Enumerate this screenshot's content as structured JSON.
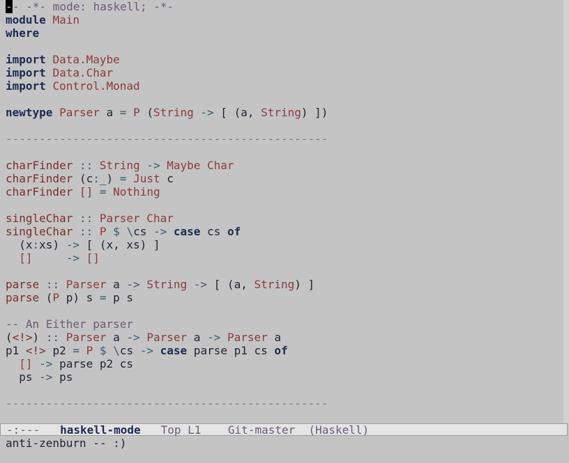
{
  "buffer": {
    "lines": [
      [
        {
          "t": "cursor",
          "s": "-"
        },
        {
          "t": "comment",
          "s": "- -*- mode: haskell; -*-"
        }
      ],
      [
        {
          "t": "keyword",
          "s": "module"
        },
        {
          "t": "plain",
          "s": " "
        },
        {
          "t": "type",
          "s": "Main"
        }
      ],
      [
        {
          "t": "keyword",
          "s": "where"
        }
      ],
      [],
      [
        {
          "t": "keyword",
          "s": "import"
        },
        {
          "t": "plain",
          "s": " "
        },
        {
          "t": "type",
          "s": "Data.Maybe"
        }
      ],
      [
        {
          "t": "keyword",
          "s": "import"
        },
        {
          "t": "plain",
          "s": " "
        },
        {
          "t": "type",
          "s": "Data.Char"
        }
      ],
      [
        {
          "t": "keyword",
          "s": "import"
        },
        {
          "t": "plain",
          "s": " "
        },
        {
          "t": "type",
          "s": "Control.Monad"
        }
      ],
      [],
      [
        {
          "t": "keyword",
          "s": "newtype"
        },
        {
          "t": "plain",
          "s": " "
        },
        {
          "t": "type",
          "s": "Parser"
        },
        {
          "t": "plain",
          "s": " a "
        },
        {
          "t": "op",
          "s": "="
        },
        {
          "t": "plain",
          "s": " "
        },
        {
          "t": "type",
          "s": "P"
        },
        {
          "t": "plain",
          "s": " ("
        },
        {
          "t": "type",
          "s": "String"
        },
        {
          "t": "plain",
          "s": " "
        },
        {
          "t": "op",
          "s": "->"
        },
        {
          "t": "plain",
          "s": " [ (a, "
        },
        {
          "t": "type",
          "s": "String"
        },
        {
          "t": "plain",
          "s": ") ])"
        }
      ],
      [],
      [
        {
          "t": "sep",
          "s": "------------------------------------------------"
        }
      ],
      [],
      [
        {
          "t": "func",
          "s": "charFinder"
        },
        {
          "t": "plain",
          "s": " "
        },
        {
          "t": "op",
          "s": "::"
        },
        {
          "t": "plain",
          "s": " "
        },
        {
          "t": "type",
          "s": "String"
        },
        {
          "t": "plain",
          "s": " "
        },
        {
          "t": "op",
          "s": "->"
        },
        {
          "t": "plain",
          "s": " "
        },
        {
          "t": "type",
          "s": "Maybe Char"
        }
      ],
      [
        {
          "t": "func",
          "s": "charFinder"
        },
        {
          "t": "plain",
          "s": " (c"
        },
        {
          "t": "op",
          "s": ":"
        },
        {
          "t": "plain",
          "s": "_) "
        },
        {
          "t": "op",
          "s": "="
        },
        {
          "t": "plain",
          "s": " "
        },
        {
          "t": "type",
          "s": "Just"
        },
        {
          "t": "plain",
          "s": " c"
        }
      ],
      [
        {
          "t": "func",
          "s": "charFinder"
        },
        {
          "t": "plain",
          "s": " "
        },
        {
          "t": "bracket",
          "s": "[]"
        },
        {
          "t": "plain",
          "s": " "
        },
        {
          "t": "op",
          "s": "="
        },
        {
          "t": "plain",
          "s": " "
        },
        {
          "t": "type",
          "s": "Nothing"
        }
      ],
      [],
      [
        {
          "t": "func",
          "s": "singleChar"
        },
        {
          "t": "plain",
          "s": " "
        },
        {
          "t": "op",
          "s": "::"
        },
        {
          "t": "plain",
          "s": " "
        },
        {
          "t": "type",
          "s": "Parser Char"
        }
      ],
      [
        {
          "t": "func",
          "s": "singleChar"
        },
        {
          "t": "plain",
          "s": " "
        },
        {
          "t": "op",
          "s": "::"
        },
        {
          "t": "plain",
          "s": " "
        },
        {
          "t": "type",
          "s": "P"
        },
        {
          "t": "plain",
          "s": " "
        },
        {
          "t": "op",
          "s": "$"
        },
        {
          "t": "plain",
          "s": " "
        },
        {
          "t": "op",
          "s": "\\"
        },
        {
          "t": "plain",
          "s": "cs "
        },
        {
          "t": "op",
          "s": "->"
        },
        {
          "t": "plain",
          "s": " "
        },
        {
          "t": "keyword",
          "s": "case"
        },
        {
          "t": "plain",
          "s": " cs "
        },
        {
          "t": "keyword",
          "s": "of"
        }
      ],
      [
        {
          "t": "plain",
          "s": "  (x"
        },
        {
          "t": "op",
          "s": ":"
        },
        {
          "t": "plain",
          "s": "xs) "
        },
        {
          "t": "op",
          "s": "->"
        },
        {
          "t": "plain",
          "s": " [ (x, xs) ]"
        }
      ],
      [
        {
          "t": "plain",
          "s": "  "
        },
        {
          "t": "bracket",
          "s": "[]"
        },
        {
          "t": "plain",
          "s": "     "
        },
        {
          "t": "op",
          "s": "->"
        },
        {
          "t": "plain",
          "s": " "
        },
        {
          "t": "bracket",
          "s": "[]"
        }
      ],
      [],
      [
        {
          "t": "func",
          "s": "parse"
        },
        {
          "t": "plain",
          "s": " "
        },
        {
          "t": "op",
          "s": "::"
        },
        {
          "t": "plain",
          "s": " "
        },
        {
          "t": "type",
          "s": "Parser"
        },
        {
          "t": "plain",
          "s": " a "
        },
        {
          "t": "op",
          "s": "->"
        },
        {
          "t": "plain",
          "s": " "
        },
        {
          "t": "type",
          "s": "String"
        },
        {
          "t": "plain",
          "s": " "
        },
        {
          "t": "op",
          "s": "->"
        },
        {
          "t": "plain",
          "s": " [ (a, "
        },
        {
          "t": "type",
          "s": "String"
        },
        {
          "t": "plain",
          "s": ") ]"
        }
      ],
      [
        {
          "t": "func",
          "s": "parse"
        },
        {
          "t": "plain",
          "s": " ("
        },
        {
          "t": "type",
          "s": "P"
        },
        {
          "t": "plain",
          "s": " p) s "
        },
        {
          "t": "op",
          "s": "="
        },
        {
          "t": "plain",
          "s": " p s"
        }
      ],
      [],
      [
        {
          "t": "comment",
          "s": "-- An Either parser"
        }
      ],
      [
        {
          "t": "plain",
          "s": "("
        },
        {
          "t": "func",
          "s": "<!>"
        },
        {
          "t": "plain",
          "s": ") "
        },
        {
          "t": "op",
          "s": "::"
        },
        {
          "t": "plain",
          "s": " "
        },
        {
          "t": "type",
          "s": "Parser"
        },
        {
          "t": "plain",
          "s": " a "
        },
        {
          "t": "op",
          "s": "->"
        },
        {
          "t": "plain",
          "s": " "
        },
        {
          "t": "type",
          "s": "Parser"
        },
        {
          "t": "plain",
          "s": " a "
        },
        {
          "t": "op",
          "s": "->"
        },
        {
          "t": "plain",
          "s": " "
        },
        {
          "t": "type",
          "s": "Parser"
        },
        {
          "t": "plain",
          "s": " a"
        }
      ],
      [
        {
          "t": "plain",
          "s": "p1 "
        },
        {
          "t": "func",
          "s": "<!>"
        },
        {
          "t": "plain",
          "s": " p2 "
        },
        {
          "t": "op",
          "s": "="
        },
        {
          "t": "plain",
          "s": " "
        },
        {
          "t": "type",
          "s": "P"
        },
        {
          "t": "plain",
          "s": " "
        },
        {
          "t": "op",
          "s": "$"
        },
        {
          "t": "plain",
          "s": " "
        },
        {
          "t": "op",
          "s": "\\"
        },
        {
          "t": "plain",
          "s": "cs "
        },
        {
          "t": "op",
          "s": "->"
        },
        {
          "t": "plain",
          "s": " "
        },
        {
          "t": "keyword",
          "s": "case"
        },
        {
          "t": "plain",
          "s": " parse p1 cs "
        },
        {
          "t": "keyword",
          "s": "of"
        }
      ],
      [
        {
          "t": "plain",
          "s": "  "
        },
        {
          "t": "bracket",
          "s": "[]"
        },
        {
          "t": "plain",
          "s": " "
        },
        {
          "t": "op",
          "s": "->"
        },
        {
          "t": "plain",
          "s": " parse p2 cs"
        }
      ],
      [
        {
          "t": "plain",
          "s": "  ps "
        },
        {
          "t": "op",
          "s": "->"
        },
        {
          "t": "plain",
          "s": " ps"
        }
      ],
      [],
      [
        {
          "t": "sep",
          "s": "------------------------------------------------"
        }
      ],
      []
    ]
  },
  "mode_line": {
    "status": "-:---",
    "buffer_name": "haskell-mode",
    "position": "Top L1",
    "vc": "Git-master",
    "major_mode": "(Haskell)"
  },
  "echo_area": {
    "message": "anti-zenburn -- :)"
  },
  "colors": {
    "background": "#c4c4c4",
    "keyword": "#1c2a52",
    "type": "#8a3b3b",
    "comment": "#6b5a7a",
    "mode_line_bg": "#e4e4e4"
  }
}
